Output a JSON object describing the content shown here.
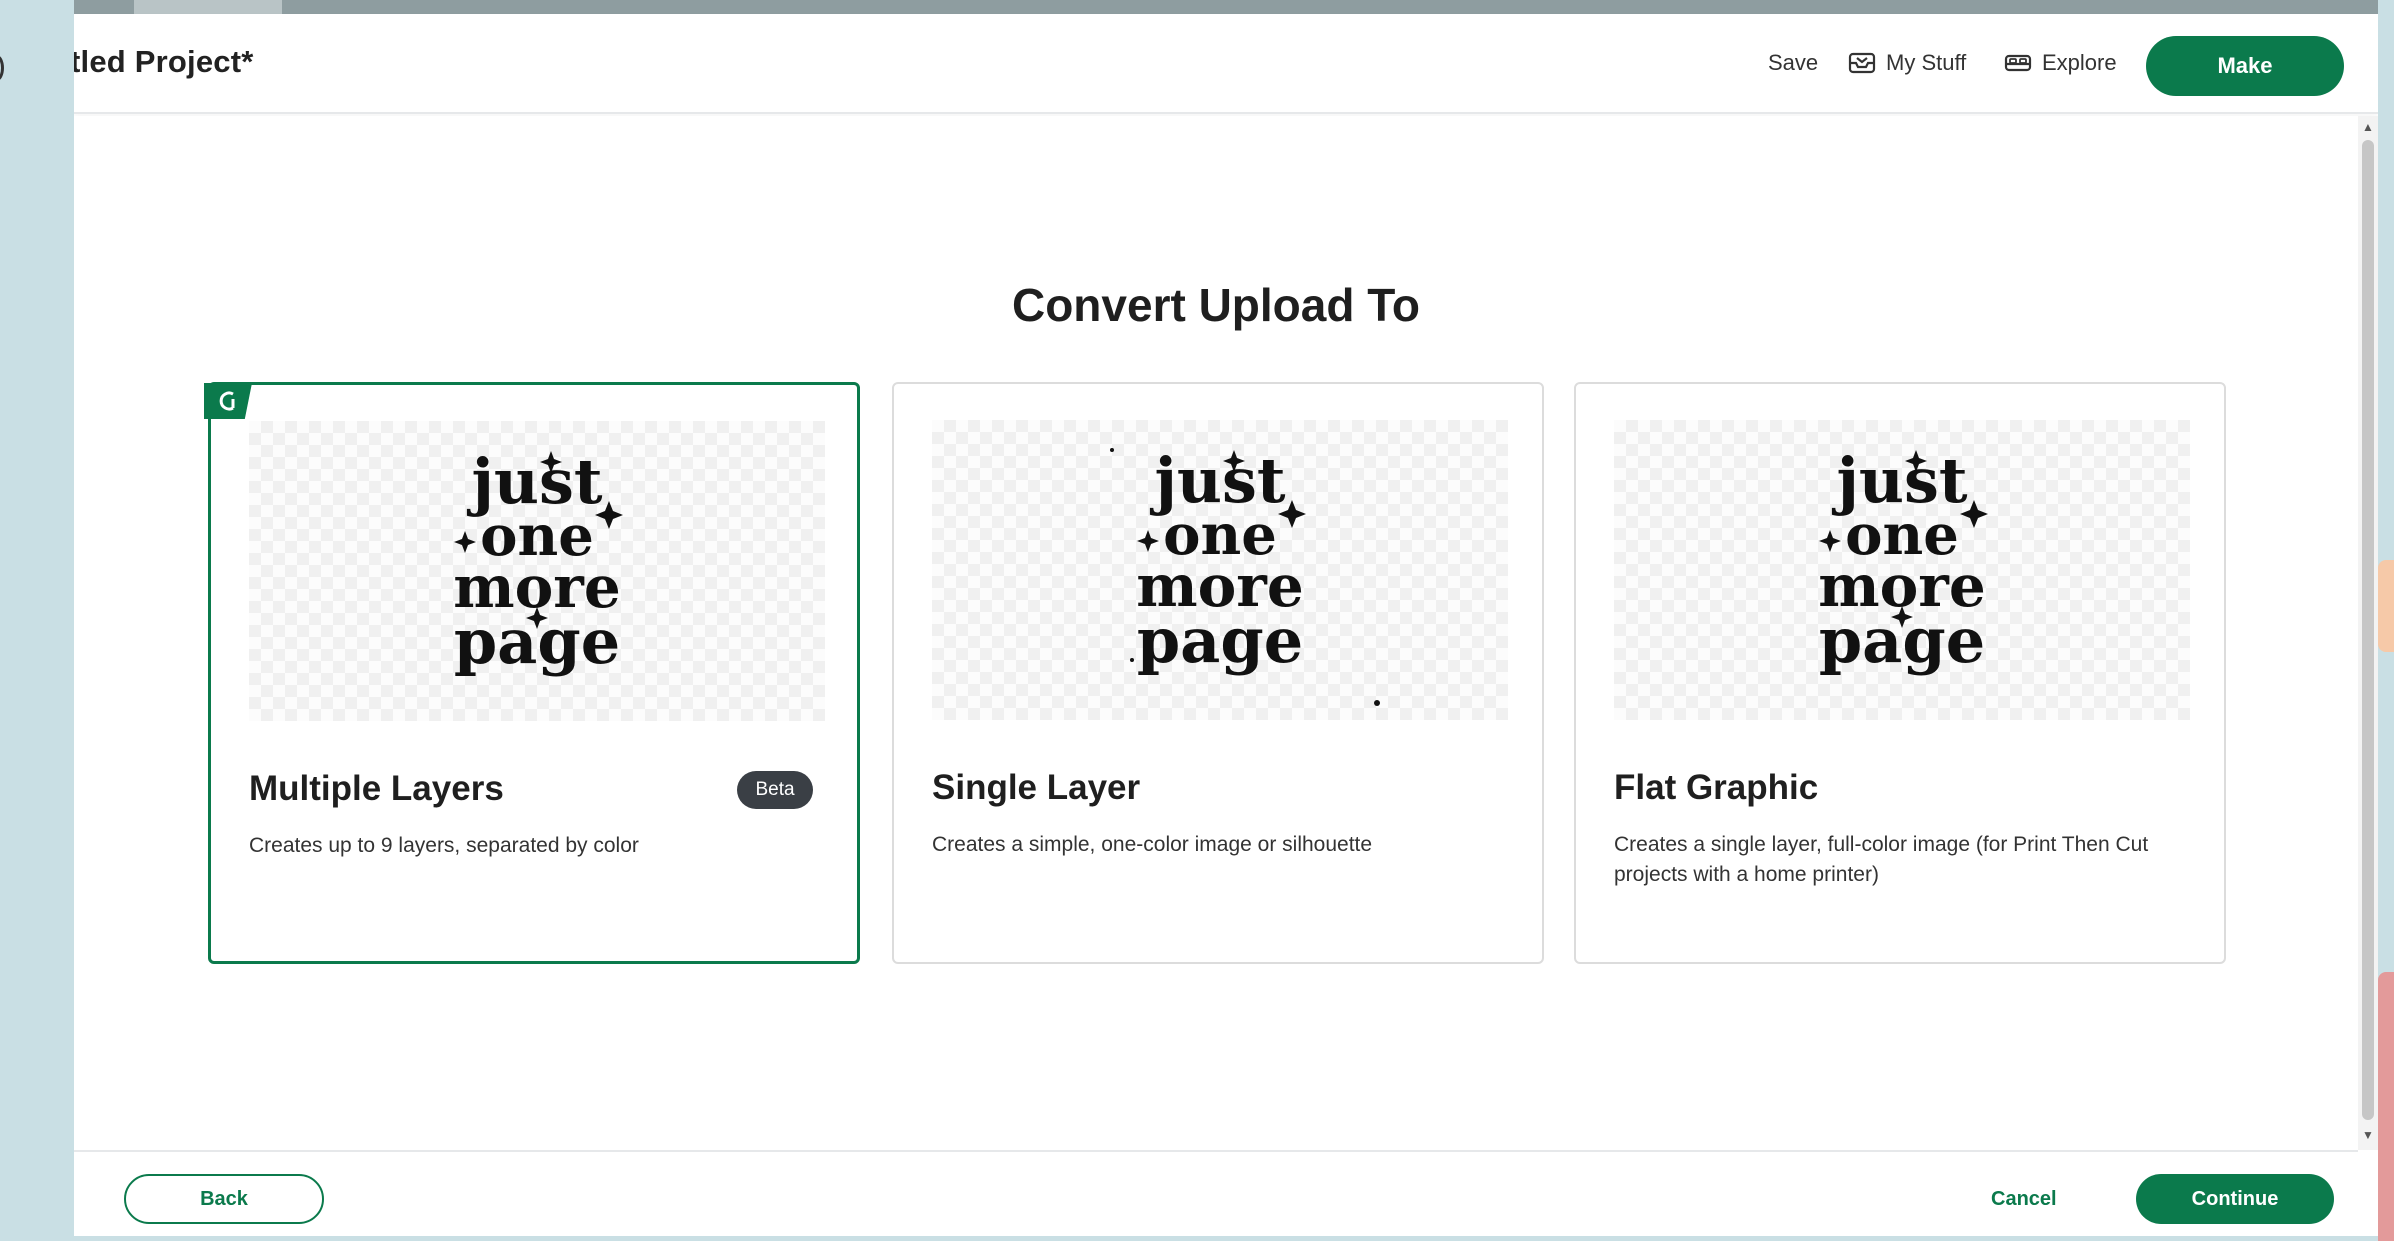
{
  "header": {
    "project_title": "tled Project*",
    "save_label": "Save",
    "mystuff_label": "My Stuff",
    "explore_label": "Explore",
    "make_label": "Make",
    "mystuff_icon": "inbox-icon",
    "explore_icon": "bed-icon"
  },
  "dialog": {
    "title": "Convert Upload To",
    "options": [
      {
        "title": "Multiple Layers",
        "badge": "Beta",
        "description": "Creates up to 9 layers, separated by color",
        "selected": true,
        "image_text": [
          "just",
          "one",
          "more",
          "page"
        ]
      },
      {
        "title": "Single Layer",
        "description": "Creates a simple, one-color image or silhouette",
        "selected": false,
        "image_text": [
          "just",
          "one",
          "more",
          "page"
        ]
      },
      {
        "title": "Flat Graphic",
        "description": "Creates a single layer, full-color image (for Print Then Cut projects with a home printer)",
        "selected": false,
        "image_text": [
          "just",
          "one",
          "more",
          "page"
        ]
      }
    ]
  },
  "footer": {
    "back_label": "Back",
    "cancel_label": "Cancel",
    "continue_label": "Continue"
  },
  "colors": {
    "brand_green": "#0b7a4c",
    "badge_dark": "#3a3f45",
    "desktop_bg": "#c9dfe4"
  }
}
